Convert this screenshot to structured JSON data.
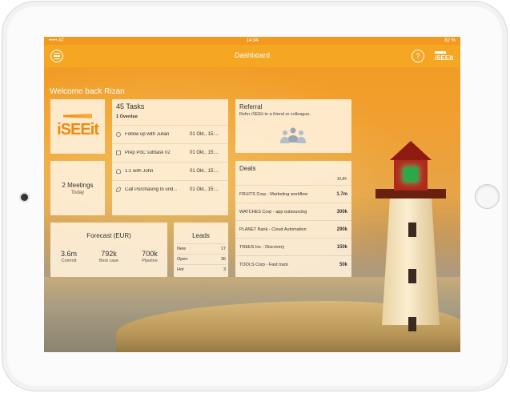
{
  "status_bar": {
    "carrier": "••••• AT",
    "time": "14:34",
    "battery": "82 %"
  },
  "nav": {
    "title": "Dashboard",
    "help_label": "?",
    "logo": "iSEEit"
  },
  "welcome": "Welcome back Rizan",
  "logo_tile": {
    "text": "iSEEit"
  },
  "meetings": {
    "title": "2 Meetings",
    "subtitle": "Today"
  },
  "tasks": {
    "title": "45 Tasks",
    "overdue": "1 Overdue",
    "items": [
      {
        "name": "Follow up with Julian",
        "date": "01 Okt., 15:...",
        "icon": "speech-bubble-icon"
      },
      {
        "name": "Prep PoC subtask 02",
        "date": "01 Okt., 15:...",
        "icon": "document-icon"
      },
      {
        "name": "1:1 with John",
        "date": "01 Okt., 15:...",
        "icon": "people-icon"
      },
      {
        "name": "Call Purchasing to und...",
        "date": "01 Okt., 15:...",
        "icon": "phone-icon"
      }
    ]
  },
  "forecast": {
    "title": "Forecast (EUR)",
    "columns": [
      {
        "value": "3.6m",
        "label": "Commit"
      },
      {
        "value": "792k",
        "label": "Best case"
      },
      {
        "value": "700k",
        "label": "Pipeline"
      }
    ]
  },
  "leads": {
    "title": "Leads",
    "rows": [
      {
        "label": "New",
        "count": "17"
      },
      {
        "label": "Open",
        "count": "36"
      },
      {
        "label": "Hot",
        "count": "3"
      }
    ]
  },
  "referral": {
    "title": "Referral",
    "text": "Refer iSEEit to a friend or colleague."
  },
  "deals": {
    "title": "Deals",
    "currency": "EUR",
    "rows": [
      {
        "name": "FRUITS Corp - Marketing workflow",
        "value": "1.7m"
      },
      {
        "name": "WATCHES Corp - app outsourcing",
        "value": "300k"
      },
      {
        "name": "PLANET Bank - Cloud Automation",
        "value": "290k"
      },
      {
        "name": "TREES Inc - Discovery",
        "value": "150k"
      },
      {
        "name": "TOOLS Corp - Fast track",
        "value": "50k"
      }
    ]
  },
  "colors": {
    "accent": "#f5a623",
    "card_bg": "#fff1da",
    "logo_orange": "#f08a10"
  }
}
